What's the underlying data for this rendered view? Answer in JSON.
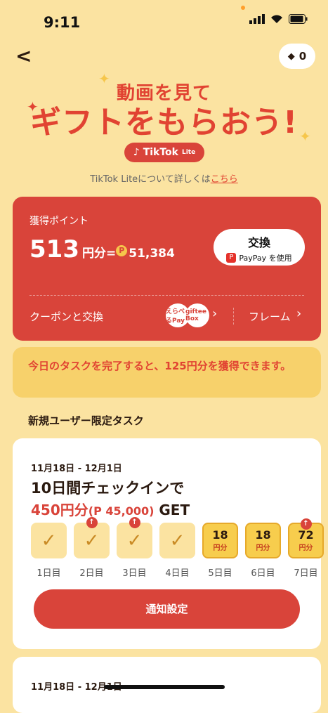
{
  "status": {
    "time": "9:11"
  },
  "header": {
    "back": "<",
    "badge_count": "0"
  },
  "hero": {
    "line1": "動画を見て",
    "line2": "ギフトをもらおう!",
    "brand": "TikTok",
    "brand_sub": "Lite"
  },
  "info": {
    "text": "TikTok Liteについて詳しくは",
    "link": "こちら"
  },
  "points": {
    "label": "獲得ポイント",
    "value": "513",
    "unit": "円分",
    "eq": "=",
    "coin": "51,384",
    "exchange_title": "交換",
    "exchange_sub": "PayPay を使用",
    "coupon": "クーポンと交換",
    "giftee_a": "えらべるPay",
    "giftee_b": "giftee Box",
    "frame": "フレーム"
  },
  "banner": {
    "text": "今日のタスクを完了すると、125円分を獲得できます。"
  },
  "section": {
    "title": "新規ユーザー限定タスク"
  },
  "task": {
    "date": "11月18日 - 12月1日",
    "title": "10日間チェックインで",
    "reward_red": "450円分",
    "reward_paren": "(P 45,000)",
    "reward_get": " GET",
    "days": [
      {
        "label": "1日目"
      },
      {
        "label": "2日目"
      },
      {
        "label": "3日目"
      },
      {
        "label": "4日目"
      },
      {
        "label": "5日目",
        "amount": "18",
        "unit": "円分"
      },
      {
        "label": "6日目",
        "amount": "18",
        "unit": "円分"
      },
      {
        "label": "7日目",
        "amount": "72",
        "unit": "円分"
      }
    ],
    "notify": "通知設定"
  },
  "task2": {
    "date": "11月18日 - 12月1日"
  }
}
